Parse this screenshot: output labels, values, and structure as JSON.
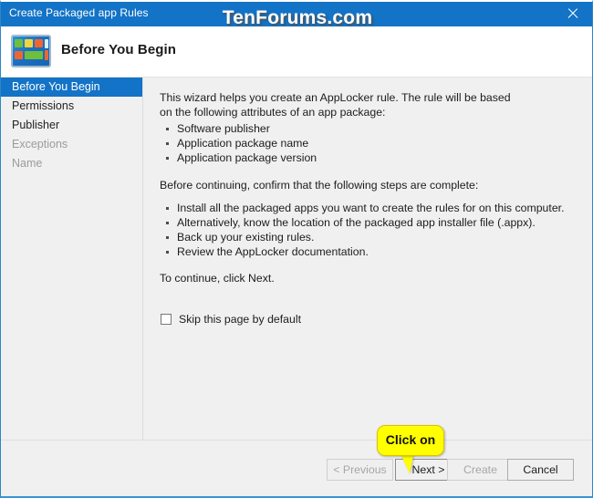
{
  "window": {
    "title": "Create Packaged app Rules",
    "close_icon": "close-icon",
    "accent_color": "#1373c6",
    "body_color": "#f0f0f0"
  },
  "watermark": {
    "text": "TenForums.com"
  },
  "header": {
    "icon": "packaged-app-icon",
    "title": "Before You Begin"
  },
  "sidebar": {
    "items": [
      {
        "label": "Before You Begin",
        "state": "selected"
      },
      {
        "label": "Permissions",
        "state": "enabled"
      },
      {
        "label": "Publisher",
        "state": "enabled"
      },
      {
        "label": "Exceptions",
        "state": "disabled"
      },
      {
        "label": "Name",
        "state": "disabled"
      }
    ]
  },
  "content": {
    "intro": "This wizard helps you create an AppLocker rule. The rule will be based on the following attributes of an app package:",
    "attributes": [
      "Software publisher",
      "Application package name",
      "Application package version"
    ],
    "confirm_heading": "Before continuing, confirm that the following steps are complete:",
    "steps": [
      "Install all the packaged apps you want to create the rules for on this computer.",
      "Alternatively, know the location of the packaged app installer file (.appx).",
      "Back up your existing rules.",
      "Review the AppLocker documentation."
    ],
    "continue_text": "To continue, click Next.",
    "skip_checkbox": {
      "label": "Skip this page by default",
      "checked": false
    }
  },
  "footer": {
    "buttons": [
      {
        "label": "< Previous",
        "state": "disabled"
      },
      {
        "label": "Next >",
        "state": "enabled"
      },
      {
        "label": "Create",
        "state": "disabled"
      },
      {
        "label": "Cancel",
        "state": "enabled"
      }
    ]
  },
  "callout": {
    "text": "Click on",
    "color": "#ffff00",
    "points_to": "Next >"
  }
}
